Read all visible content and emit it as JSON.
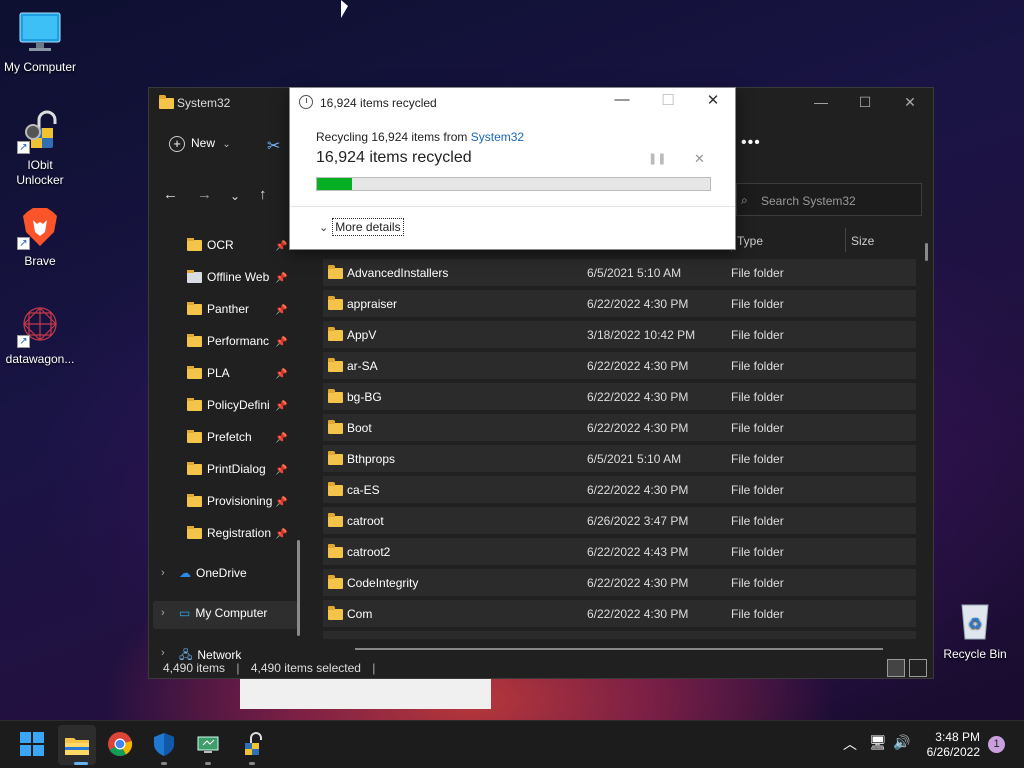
{
  "desktop": {
    "icons": [
      {
        "label": "My Computer"
      },
      {
        "label": "IObit\nUnlocker",
        "line1": "IObit",
        "line2": "Unlocker"
      },
      {
        "label": "Brave"
      },
      {
        "label": "datawagon..."
      }
    ],
    "recycle_bin": "Recycle Bin"
  },
  "explorer": {
    "title": "System32",
    "new_label": "New",
    "search_placeholder": "Search System32",
    "col_type": "Type",
    "col_size": "Size",
    "sidebar": [
      {
        "label": "OCR"
      },
      {
        "label": "Offline Web"
      },
      {
        "label": "Panther"
      },
      {
        "label": "Performanc"
      },
      {
        "label": "PLA"
      },
      {
        "label": "PolicyDefini"
      },
      {
        "label": "Prefetch"
      },
      {
        "label": "PrintDialog"
      },
      {
        "label": "Provisioning"
      },
      {
        "label": "Registration"
      }
    ],
    "onedrive": "OneDrive",
    "my_computer": "My Computer",
    "network": "Network",
    "rows": [
      {
        "name": "AdvancedInstallers",
        "date": "6/5/2021 5:10 AM",
        "type": "File folder"
      },
      {
        "name": "appraiser",
        "date": "6/22/2022 4:30 PM",
        "type": "File folder"
      },
      {
        "name": "AppV",
        "date": "3/18/2022 10:42 PM",
        "type": "File folder"
      },
      {
        "name": "ar-SA",
        "date": "6/22/2022 4:30 PM",
        "type": "File folder"
      },
      {
        "name": "bg-BG",
        "date": "6/22/2022 4:30 PM",
        "type": "File folder"
      },
      {
        "name": "Boot",
        "date": "6/22/2022 4:30 PM",
        "type": "File folder"
      },
      {
        "name": "Bthprops",
        "date": "6/5/2021 5:10 AM",
        "type": "File folder"
      },
      {
        "name": "ca-ES",
        "date": "6/22/2022 4:30 PM",
        "type": "File folder"
      },
      {
        "name": "catroot",
        "date": "6/26/2022 3:47 PM",
        "type": "File folder"
      },
      {
        "name": "catroot2",
        "date": "6/22/2022 4:43 PM",
        "type": "File folder"
      },
      {
        "name": "CodeIntegrity",
        "date": "6/22/2022 4:30 PM",
        "type": "File folder"
      },
      {
        "name": "Com",
        "date": "6/22/2022 4:30 PM",
        "type": "File folder"
      }
    ],
    "status_items": "4,490 items",
    "status_selected": "4,490 items selected"
  },
  "dialog": {
    "title": "16,924 items recycled",
    "from_prefix": "Recycling 16,924 items from ",
    "from_link": "System32",
    "heading": "16,924 items recycled",
    "progress_fraction": 0.09,
    "more_details": "More details"
  },
  "taskbar": {
    "time": "3:48 PM",
    "date": "6/26/2022",
    "notification_count": "1"
  }
}
